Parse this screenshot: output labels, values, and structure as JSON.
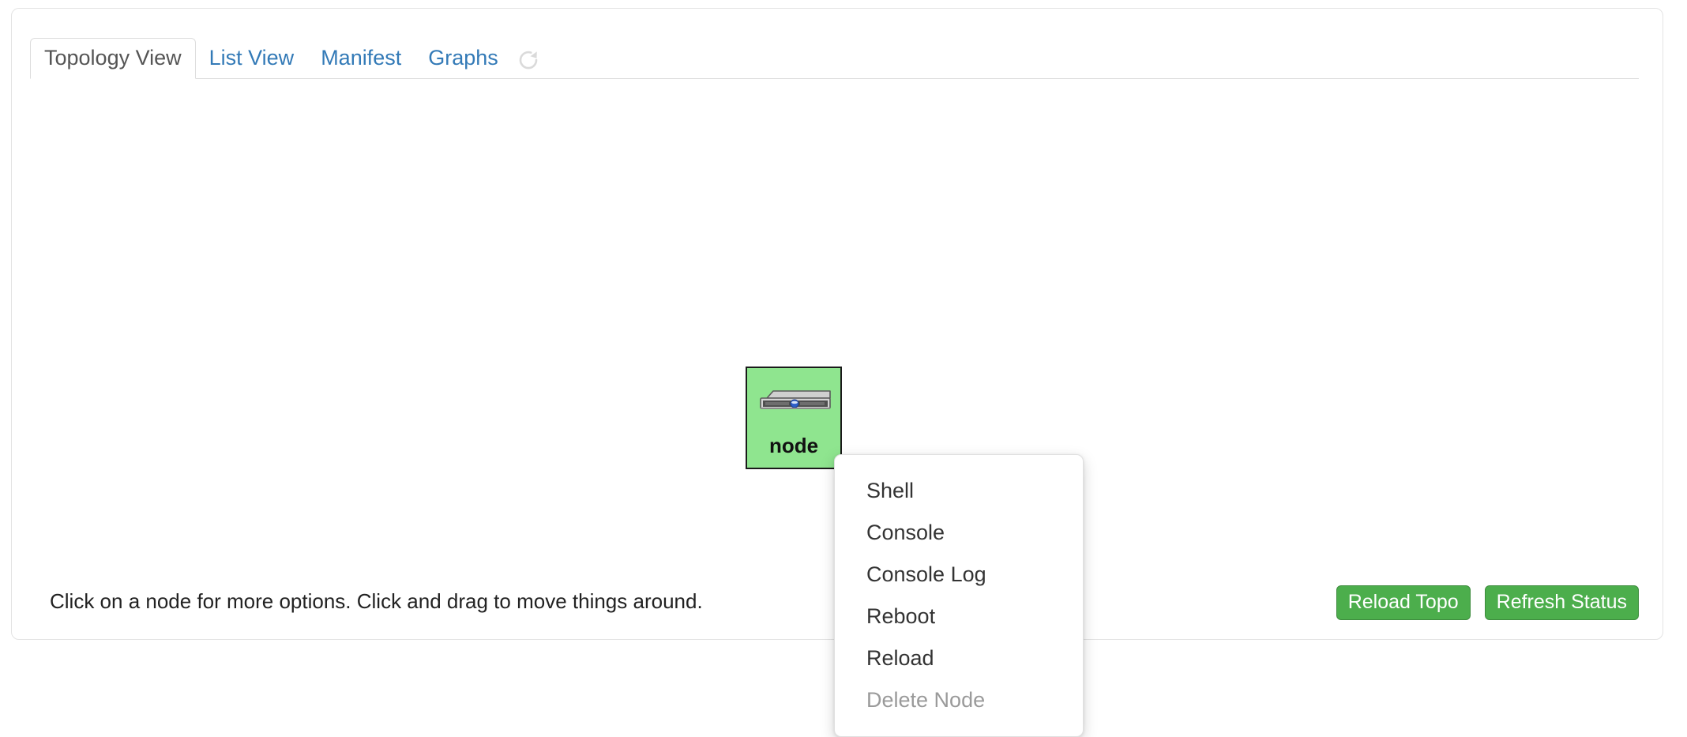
{
  "panel": {
    "tabs": [
      {
        "label": "Topology View",
        "active": true,
        "name": "tab-topology-view"
      },
      {
        "label": "List View",
        "active": false,
        "name": "tab-list-view"
      },
      {
        "label": "Manifest",
        "active": false,
        "name": "tab-manifest"
      },
      {
        "label": "Graphs",
        "active": false,
        "name": "tab-graphs"
      }
    ],
    "refresh_spinner_icon": "refresh-spinner-icon"
  },
  "topology": {
    "node": {
      "label": "node",
      "icon": "server-node-icon",
      "status_color": "#8fe58f",
      "border_color": "#1a1a1a"
    }
  },
  "context_menu": {
    "items": [
      {
        "label": "Shell",
        "disabled": false,
        "name": "menu-item-shell"
      },
      {
        "label": "Console",
        "disabled": false,
        "name": "menu-item-console"
      },
      {
        "label": "Console Log",
        "disabled": false,
        "name": "menu-item-console-log"
      },
      {
        "label": "Reboot",
        "disabled": false,
        "name": "menu-item-reboot"
      },
      {
        "label": "Reload",
        "disabled": false,
        "name": "menu-item-reload"
      },
      {
        "label": "Delete Node",
        "disabled": true,
        "name": "menu-item-delete-node"
      }
    ]
  },
  "footer": {
    "hint": "Click on a node for more options. Click and drag to move things around.",
    "reload_topo_label": "Reload Topo",
    "refresh_status_label": "Refresh Status",
    "button_color": "#4cae4c"
  }
}
